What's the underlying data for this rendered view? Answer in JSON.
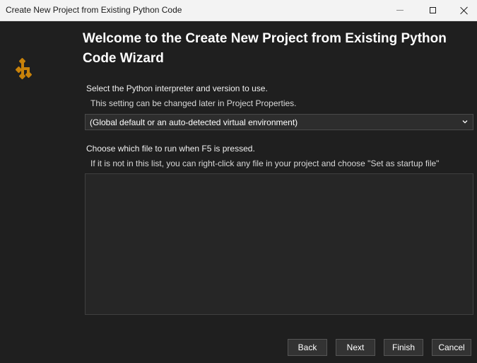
{
  "window": {
    "title": "Create New Project from Existing Python Code"
  },
  "colors": {
    "accent_icon": "#c8820a",
    "background": "#1f1f1f"
  },
  "wizard": {
    "heading": "Welcome to the Create New Project from Existing Python Code Wizard",
    "interpreter_label": "Select the Python interpreter and version to use.",
    "interpreter_sublabel": "This setting can be changed later in Project Properties.",
    "interpreter_selected": "(Global default or an auto-detected virtual environment)",
    "startup_label": "Choose which file to run when F5 is pressed.",
    "startup_sublabel": "If it is not in this list, you can right-click any file in your project and choose \"Set as startup file\""
  },
  "buttons": {
    "back": "Back",
    "next": "Next",
    "finish": "Finish",
    "cancel": "Cancel"
  }
}
